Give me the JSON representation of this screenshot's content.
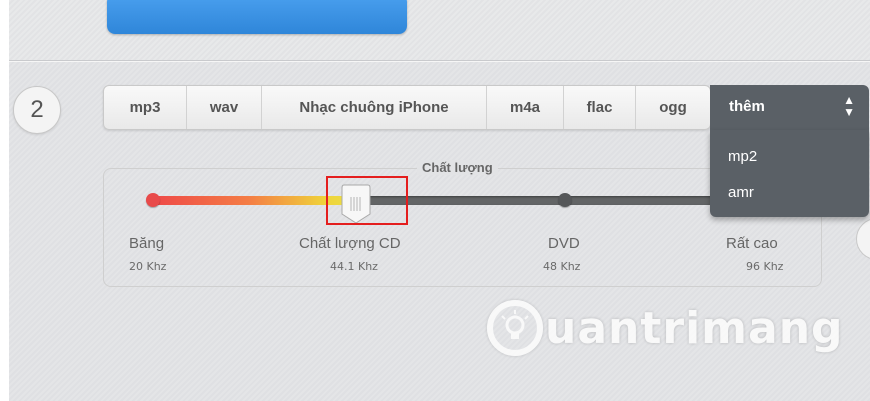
{
  "step": {
    "number": "2"
  },
  "formats": {
    "tabs": [
      {
        "label": "mp3"
      },
      {
        "label": "wav"
      },
      {
        "label": "Nhạc chuông iPhone"
      },
      {
        "label": "m4a"
      },
      {
        "label": "flac"
      },
      {
        "label": "ogg"
      }
    ],
    "more": {
      "label": "thêm",
      "icon": "up-down-arrows-icon"
    },
    "dropdown_options": [
      {
        "label": "mp2"
      },
      {
        "label": "amr"
      }
    ]
  },
  "quality": {
    "title": "Chất lượng",
    "selected_level": 1,
    "levels": [
      {
        "label": "Băng",
        "rate": "20 Khz"
      },
      {
        "label": "Chất lượng CD",
        "rate": "44.1 Khz"
      },
      {
        "label": "DVD",
        "rate": "48 Khz"
      },
      {
        "label": "Rất cao",
        "rate": "96 Khz"
      }
    ]
  },
  "watermark": {
    "text": "uantrimang"
  },
  "colors": {
    "accent_blue": "#3a93e4",
    "highlight_red": "#e41e1e",
    "dropdown_bg": "#5a6066"
  }
}
